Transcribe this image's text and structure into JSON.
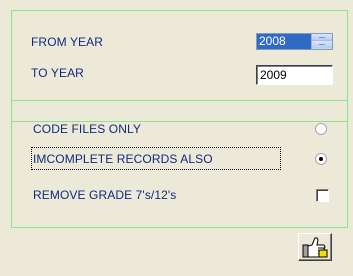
{
  "years": {
    "from_label": "FROM YEAR",
    "from_value": "2008",
    "to_label": "TO YEAR",
    "to_value": "2009"
  },
  "options": {
    "code_files_label": "CODE FILES ONLY",
    "code_files_selected": false,
    "incomplete_label": "IMCOMPLETE RECORDS ALSO",
    "incomplete_selected": true,
    "remove_grade_label": "REMOVE GRADE 7's/12's",
    "remove_grade_checked": false
  },
  "ok_button": {
    "icon": "thumbs-up-icon"
  },
  "colors": {
    "label_text": "#102a80",
    "panel_border": "#88e888",
    "background": "#ece9d8",
    "selection": "#316ac5"
  }
}
